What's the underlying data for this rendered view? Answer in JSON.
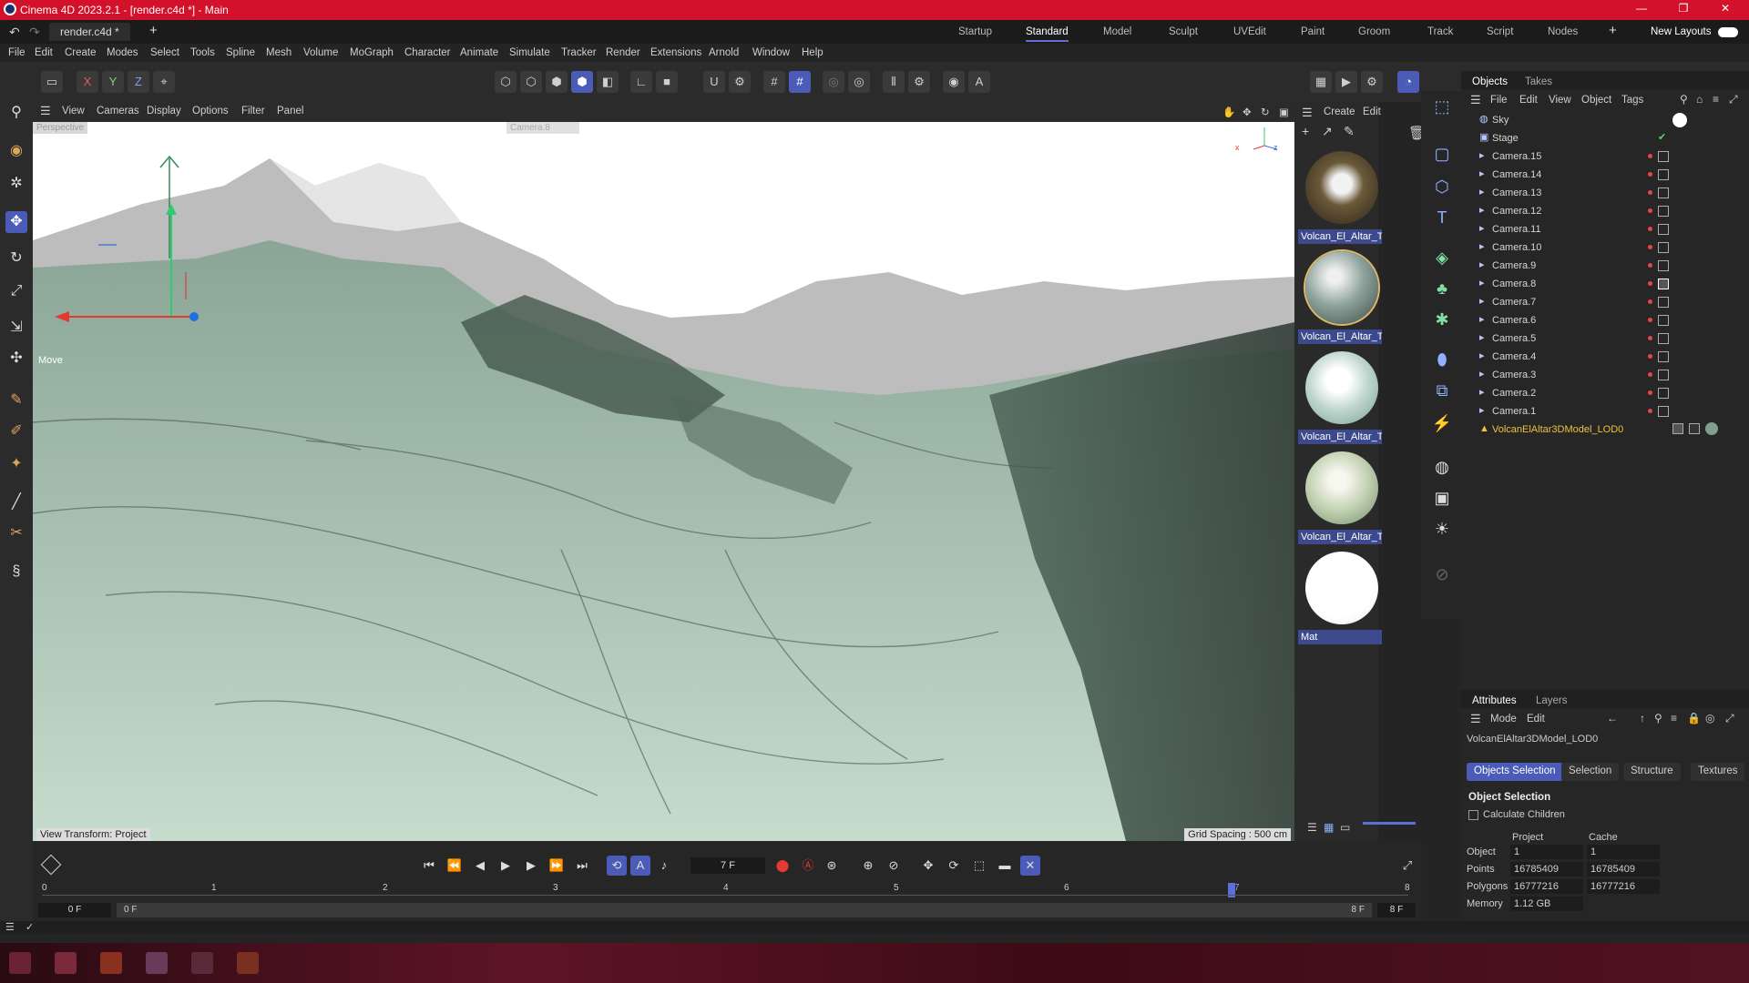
{
  "window": {
    "title": "Cinema 4D 2023.2.1 - [render.c4d *] - Main"
  },
  "doc_tab": "render.c4d *",
  "layouts": [
    "Startup",
    "Standard",
    "Model",
    "Sculpt",
    "UVEdit",
    "Paint",
    "Groom",
    "Track",
    "Script",
    "Nodes"
  ],
  "new_layouts": "New Layouts",
  "menus": [
    "File",
    "Edit",
    "Create",
    "Modes",
    "Select",
    "Tools",
    "Spline",
    "Mesh",
    "Volume",
    "MoGraph",
    "Character",
    "Animate",
    "Simulate",
    "Tracker",
    "Render",
    "Extensions",
    "Arnold",
    "Window",
    "Help"
  ],
  "axis_toggles": [
    "X",
    "Y",
    "Z"
  ],
  "viewport": {
    "menu": [
      "View",
      "Cameras",
      "Display",
      "Options",
      "Filter",
      "Panel"
    ],
    "label_persp": "Perspective",
    "label_camera": "Camera.8",
    "tool_label": "Move",
    "view_transform": "View Transform: Project",
    "grid_spacing": "Grid Spacing : 500 cm"
  },
  "materials": {
    "menu": [
      "Create",
      "Edit"
    ],
    "items": [
      {
        "name": "Volcan_El_Altar_Te",
        "color": "#6b5a3a"
      },
      {
        "name": "Volcan_El_Altar_Te",
        "color": "#8fa39d"
      },
      {
        "name": "Volcan_El_Altar_Te",
        "color": "#bfd6cf"
      },
      {
        "name": "Volcan_El_Altar_Te",
        "color": "#c3d2b3"
      },
      {
        "name": "Mat",
        "color": "#ffffff"
      }
    ]
  },
  "objects": {
    "tabs": [
      "Objects",
      "Takes"
    ],
    "menu": [
      "File",
      "Edit",
      "View",
      "Object",
      "Tags"
    ],
    "items": [
      "Sky",
      "Stage",
      "Camera.15",
      "Camera.14",
      "Camera.13",
      "Camera.12",
      "Camera.11",
      "Camera.10",
      "Camera.9",
      "Camera.8",
      "Camera.7",
      "Camera.6",
      "Camera.5",
      "Camera.4",
      "Camera.3",
      "Camera.2",
      "Camera.1",
      "VolcanElAltar3DModel_LOD0"
    ]
  },
  "attributes": {
    "tabs": [
      "Attributes",
      "Layers"
    ],
    "menu": [
      "Mode",
      "Edit"
    ],
    "object_name": "VolcanElAltar3DModel_LOD0",
    "buttons": [
      "Objects Selection",
      "Selection",
      "Structure",
      "Textures"
    ],
    "section": "Object Selection",
    "checkbox": "Calculate Children",
    "col_headers": [
      "Project",
      "Cache"
    ],
    "rows": [
      {
        "label": "Object",
        "project": "1",
        "cache": "1"
      },
      {
        "label": "Points",
        "project": "16785409",
        "cache": "16785409"
      },
      {
        "label": "Polygons",
        "project": "16777216",
        "cache": "16777216"
      },
      {
        "label": "Memory",
        "project": "1.12 GB",
        "cache": ""
      }
    ]
  },
  "timeline": {
    "current_frame": "7 F",
    "ticks": [
      "0",
      "1",
      "2",
      "3",
      "4",
      "5",
      "6",
      "7",
      "8"
    ],
    "start": "0 F",
    "range_start": "0 F",
    "range_end": "8 F",
    "end": "8 F"
  },
  "colors": {
    "accent": "#4b5bb8",
    "title_bg": "#d3112b",
    "terrain": "#9fbca8"
  }
}
